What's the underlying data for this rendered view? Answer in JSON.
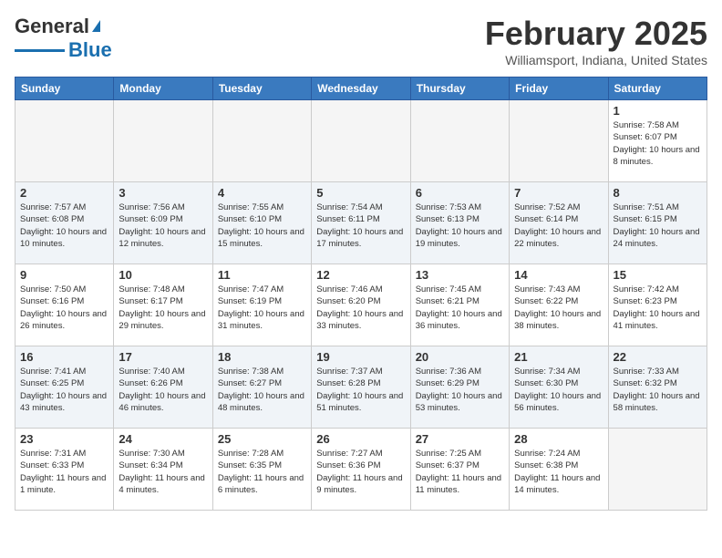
{
  "header": {
    "logo_line1": "General",
    "logo_line2": "Blue",
    "month": "February 2025",
    "location": "Williamsport, Indiana, United States"
  },
  "weekdays": [
    "Sunday",
    "Monday",
    "Tuesday",
    "Wednesday",
    "Thursday",
    "Friday",
    "Saturday"
  ],
  "weeks": [
    [
      {
        "day": "",
        "empty": true
      },
      {
        "day": "",
        "empty": true
      },
      {
        "day": "",
        "empty": true
      },
      {
        "day": "",
        "empty": true
      },
      {
        "day": "",
        "empty": true
      },
      {
        "day": "",
        "empty": true
      },
      {
        "day": "1",
        "sunrise": "7:58 AM",
        "sunset": "6:07 PM",
        "daylight": "10 hours and 8 minutes."
      }
    ],
    [
      {
        "day": "2",
        "sunrise": "7:57 AM",
        "sunset": "6:08 PM",
        "daylight": "10 hours and 10 minutes."
      },
      {
        "day": "3",
        "sunrise": "7:56 AM",
        "sunset": "6:09 PM",
        "daylight": "10 hours and 12 minutes."
      },
      {
        "day": "4",
        "sunrise": "7:55 AM",
        "sunset": "6:10 PM",
        "daylight": "10 hours and 15 minutes."
      },
      {
        "day": "5",
        "sunrise": "7:54 AM",
        "sunset": "6:11 PM",
        "daylight": "10 hours and 17 minutes."
      },
      {
        "day": "6",
        "sunrise": "7:53 AM",
        "sunset": "6:13 PM",
        "daylight": "10 hours and 19 minutes."
      },
      {
        "day": "7",
        "sunrise": "7:52 AM",
        "sunset": "6:14 PM",
        "daylight": "10 hours and 22 minutes."
      },
      {
        "day": "8",
        "sunrise": "7:51 AM",
        "sunset": "6:15 PM",
        "daylight": "10 hours and 24 minutes."
      }
    ],
    [
      {
        "day": "9",
        "sunrise": "7:50 AM",
        "sunset": "6:16 PM",
        "daylight": "10 hours and 26 minutes."
      },
      {
        "day": "10",
        "sunrise": "7:48 AM",
        "sunset": "6:17 PM",
        "daylight": "10 hours and 29 minutes."
      },
      {
        "day": "11",
        "sunrise": "7:47 AM",
        "sunset": "6:19 PM",
        "daylight": "10 hours and 31 minutes."
      },
      {
        "day": "12",
        "sunrise": "7:46 AM",
        "sunset": "6:20 PM",
        "daylight": "10 hours and 33 minutes."
      },
      {
        "day": "13",
        "sunrise": "7:45 AM",
        "sunset": "6:21 PM",
        "daylight": "10 hours and 36 minutes."
      },
      {
        "day": "14",
        "sunrise": "7:43 AM",
        "sunset": "6:22 PM",
        "daylight": "10 hours and 38 minutes."
      },
      {
        "day": "15",
        "sunrise": "7:42 AM",
        "sunset": "6:23 PM",
        "daylight": "10 hours and 41 minutes."
      }
    ],
    [
      {
        "day": "16",
        "sunrise": "7:41 AM",
        "sunset": "6:25 PM",
        "daylight": "10 hours and 43 minutes."
      },
      {
        "day": "17",
        "sunrise": "7:40 AM",
        "sunset": "6:26 PM",
        "daylight": "10 hours and 46 minutes."
      },
      {
        "day": "18",
        "sunrise": "7:38 AM",
        "sunset": "6:27 PM",
        "daylight": "10 hours and 48 minutes."
      },
      {
        "day": "19",
        "sunrise": "7:37 AM",
        "sunset": "6:28 PM",
        "daylight": "10 hours and 51 minutes."
      },
      {
        "day": "20",
        "sunrise": "7:36 AM",
        "sunset": "6:29 PM",
        "daylight": "10 hours and 53 minutes."
      },
      {
        "day": "21",
        "sunrise": "7:34 AM",
        "sunset": "6:30 PM",
        "daylight": "10 hours and 56 minutes."
      },
      {
        "day": "22",
        "sunrise": "7:33 AM",
        "sunset": "6:32 PM",
        "daylight": "10 hours and 58 minutes."
      }
    ],
    [
      {
        "day": "23",
        "sunrise": "7:31 AM",
        "sunset": "6:33 PM",
        "daylight": "11 hours and 1 minute."
      },
      {
        "day": "24",
        "sunrise": "7:30 AM",
        "sunset": "6:34 PM",
        "daylight": "11 hours and 4 minutes."
      },
      {
        "day": "25",
        "sunrise": "7:28 AM",
        "sunset": "6:35 PM",
        "daylight": "11 hours and 6 minutes."
      },
      {
        "day": "26",
        "sunrise": "7:27 AM",
        "sunset": "6:36 PM",
        "daylight": "11 hours and 9 minutes."
      },
      {
        "day": "27",
        "sunrise": "7:25 AM",
        "sunset": "6:37 PM",
        "daylight": "11 hours and 11 minutes."
      },
      {
        "day": "28",
        "sunrise": "7:24 AM",
        "sunset": "6:38 PM",
        "daylight": "11 hours and 14 minutes."
      },
      {
        "day": "",
        "empty": true
      }
    ]
  ]
}
